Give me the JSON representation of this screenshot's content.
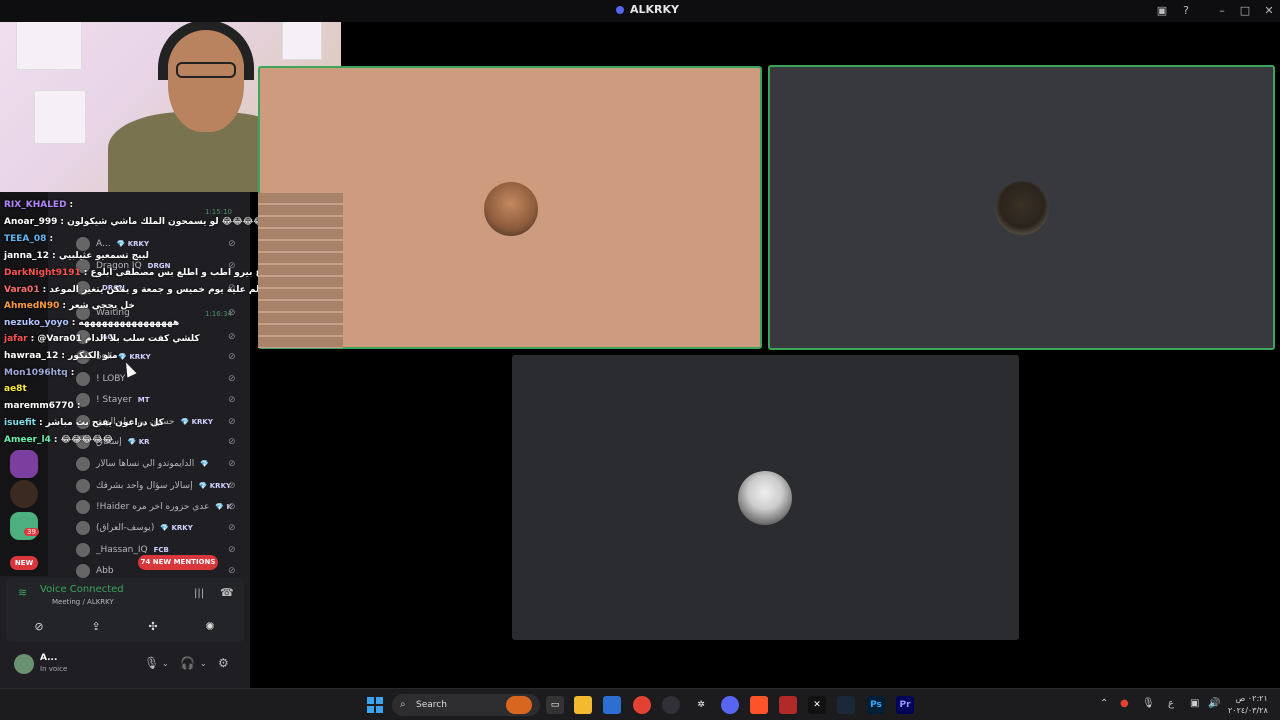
{
  "window": {
    "title": "ALKRKY"
  },
  "chat": [
    {
      "user": "RIX_KHALED",
      "color": "#b388ff",
      "text": ":"
    },
    {
      "user": "Anoar_999",
      "color": "#ffffff",
      "text": ": لو يسمحون الملك ماشي شيكولون 😂😂😂😂😂😂"
    },
    {
      "user": "TEEA_08",
      "color": "#64b5f6",
      "text": ":"
    },
    {
      "user": "janna_12",
      "color": "#ffffff",
      "text": ": لبيج تسمعيو عثيلبيي"
    },
    {
      "user": "DarkNight9191",
      "color": "#ff5252",
      "text": ": لبش الي شوكت مباوع بيرو اطب و اطلع بس مصطفى ابلوع"
    },
    {
      "user": "Vara01",
      "color": "#ff6e6e",
      "text": ": تكلم علية يوم خميس و جمعة و يمكن يتغير الموعد"
    },
    {
      "user": "AhmedN90",
      "color": "#ff9d3b",
      "text": ": خل يحجي شعر"
    },
    {
      "user": "nezuko_yoyo",
      "color": "#b0c4ff",
      "text": ": ههههههههههههههههه"
    },
    {
      "user": "jafar",
      "color": "#ff5252",
      "text": ": @Vara01 كلشي كفت سلب بلا الدام"
    },
    {
      "user": "hawraa_12",
      "color": "#ffffff",
      "text": ": متو الكنكور"
    },
    {
      "user": "Mon1096htq",
      "color": "#9fa8da",
      "text": ":"
    },
    {
      "user": "ae8t",
      "color": "#ffeb3b",
      "text": ""
    },
    {
      "user": "maremm6770",
      "color": "#ffffff",
      "text": ":"
    },
    {
      "user": "isuefit",
      "color": "#80deea",
      "text": ": كل دراعون يفتح بث مباشر"
    },
    {
      "user": "Ameer_l4",
      "color": "#69f0ae",
      "text": ": 😂😂😂😂😂"
    }
  ],
  "timestamps": [
    "1:15:10",
    "1:16:34"
  ],
  "members": [
    {
      "name": "A...",
      "tag": "💎 KRKY"
    },
    {
      "name": "Dragon IQ",
      "tag": "DRGN"
    },
    {
      "name": "",
      "tag": "DRGN"
    },
    {
      "name": "Waiting",
      "tag": ""
    },
    {
      "name": "",
      "tag": "AG"
    },
    {
      "name": "5oli",
      "tag": "💎 KRKY"
    },
    {
      "name": "! LOBY",
      "tag": ""
    },
    {
      "name": "! Stayer",
      "tag": "MT"
    },
    {
      "name": "حسون بن جبله الزين",
      "tag": "💎 KRKY"
    },
    {
      "name": "إسحاق",
      "tag": "💎 KR"
    },
    {
      "name": "الدايموندو الي نساها سالار",
      "tag": "💎"
    },
    {
      "name": "إسالار سؤال واحد بشرفك",
      "tag": "💎 KRKY"
    },
    {
      "name": "!Haider عدي حزوره اخر مره",
      "tag": "💎 K"
    },
    {
      "name": "(يوسف-العراق)",
      "tag": "💎 KRKY"
    },
    {
      "name": "_Hassan_IQ",
      "tag": "FCB"
    },
    {
      "name": "Abb",
      "tag": ""
    }
  ],
  "mentions_pill": "74 NEW MENTIONS",
  "new_badge": "NEW",
  "server_badge": "39",
  "voice": {
    "status": "Voice Connected",
    "channel": "Meeting / ALKRKY"
  },
  "user": {
    "name": "A...",
    "status": "In voice"
  },
  "meeting_header": "Meeting",
  "taskbar": {
    "search_placeholder": "Search",
    "clock_time": "٠٢:٢١ ص",
    "clock_date": "٢٠٢٤/٠٣/٢٨",
    "lang": "ع"
  },
  "colors": {
    "accent": "#5865f2",
    "connected": "#3ba55c",
    "danger": "#da373c"
  }
}
